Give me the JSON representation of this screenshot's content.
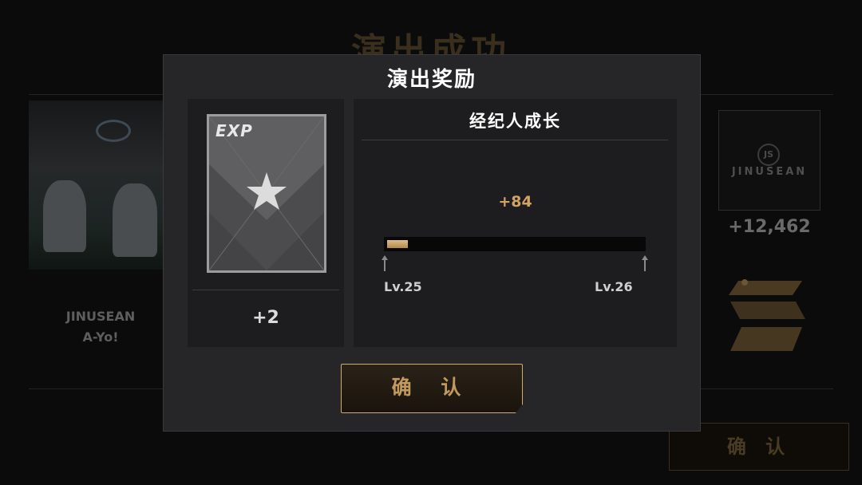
{
  "background": {
    "screen_title": "演出成功",
    "song": {
      "artist": "JINUSEAN",
      "title": "A-Yo!"
    },
    "artist_card": {
      "logo_text": "JS",
      "name": "JINUSEAN"
    },
    "score": "+12,462",
    "rank": "S",
    "confirm_label": "确 认"
  },
  "modal": {
    "title": "演出奖励",
    "reward_item": {
      "icon": "exp-card-icon",
      "label": "EXP",
      "amount": "+2"
    },
    "manager_growth": {
      "title": "经纪人成长",
      "gain": "+84",
      "progress_fraction": 0.08,
      "current_level": "Lv.25",
      "next_level": "Lv.26"
    },
    "confirm_label": "确 认"
  },
  "colors": {
    "accent_gold": "#d1a364",
    "panel": "#1d1c1e",
    "modal": "#262527"
  }
}
